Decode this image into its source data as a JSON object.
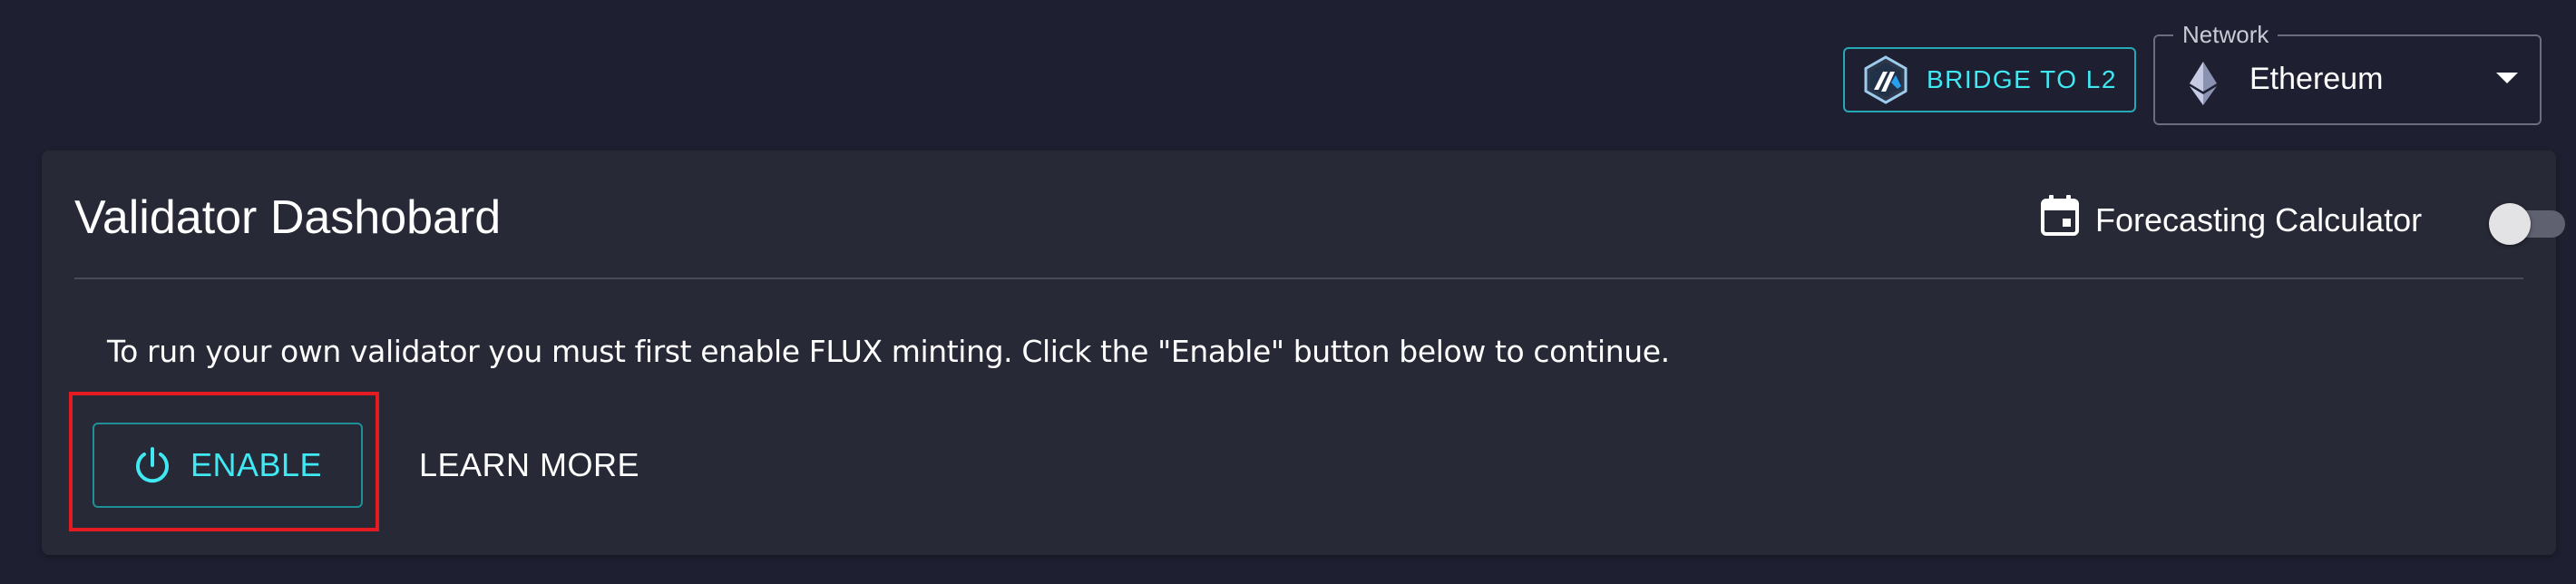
{
  "header": {
    "bridge_button": {
      "label": "BRIDGE TO L2",
      "icon": "arbitrum-logo-icon"
    },
    "network_select": {
      "legend": "Network",
      "selected": "Ethereum",
      "icon": "ethereum-icon"
    }
  },
  "dashboard": {
    "title": "Validator Dashobard",
    "forecasting": {
      "label": "Forecasting Calculator",
      "icon": "calendar-icon",
      "enabled": false
    },
    "info_text": "To run your own validator you must first enable FLUX minting. Click the \"Enable\" button below to continue.",
    "enable_button": {
      "label": "ENABLE",
      "icon": "power-icon"
    },
    "learn_more_button": {
      "label": "LEARN MORE"
    }
  },
  "colors": {
    "background": "#1e2031",
    "card": "#272936",
    "accent_cyan": "#3fe8f2",
    "highlight_red": "#e31b23"
  }
}
